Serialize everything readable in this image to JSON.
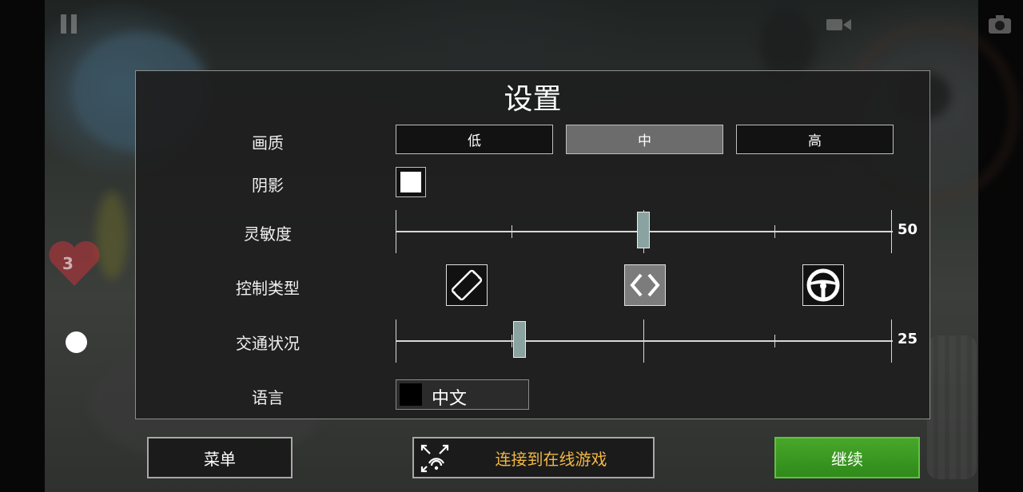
{
  "title": "设置",
  "rows": {
    "quality": "画质",
    "shadow": "阴影",
    "sensitivity": "灵敏度",
    "control_type": "控制类型",
    "traffic": "交通状况",
    "language": "语言"
  },
  "quality_options": [
    "低",
    "中",
    "高"
  ],
  "quality_selected": "中",
  "shadow_enabled": true,
  "sensitivity": {
    "value": "50",
    "min": 0,
    "max": 100,
    "level": 50
  },
  "traffic": {
    "value": "25",
    "min": 0,
    "max": 100,
    "level": 25
  },
  "control_types": [
    "tilt-phone-icon",
    "arrows-icon",
    "steering-wheel-icon"
  ],
  "control_selected": "arrows-icon",
  "language_value": "中文",
  "hud": {
    "lives": "3"
  },
  "buttons": {
    "menu": "菜单",
    "online": "连接到在线游戏",
    "continue": "继续"
  },
  "colors": {
    "continue_green": "#3f9c24",
    "online_text": "#f2b743",
    "knob": "#8aa3a1"
  }
}
